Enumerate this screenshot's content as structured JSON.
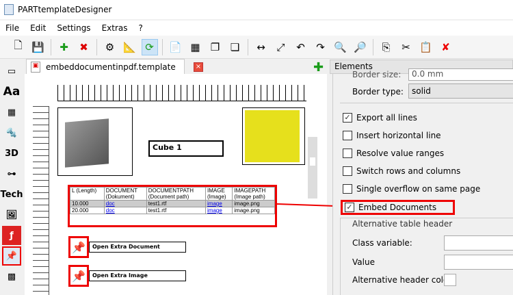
{
  "window": {
    "title": "PARTtemplateDesigner"
  },
  "menu": [
    "File",
    "Edit",
    "Settings",
    "Extras",
    "?"
  ],
  "toolbar": [
    {
      "icon": "new-file-icon",
      "g": "🗋"
    },
    {
      "icon": "save-icon",
      "g": "💾"
    },
    "sep",
    {
      "icon": "add-page-icon",
      "g": "✚"
    },
    {
      "icon": "delete-page-icon",
      "g": "✖"
    },
    "sep",
    {
      "icon": "settings-icon",
      "g": "⚙"
    },
    {
      "icon": "ruler-icon",
      "g": "📐"
    },
    {
      "icon": "refresh-icon",
      "g": "⟳",
      "active": true
    },
    "sep",
    {
      "icon": "export-pdf-icon",
      "g": "📄"
    },
    {
      "icon": "layers-icon",
      "g": "▦"
    },
    {
      "icon": "bring-front-icon",
      "g": "❐"
    },
    {
      "icon": "send-back-icon",
      "g": "❏"
    },
    "sep",
    {
      "icon": "fit-width-icon",
      "g": "↔"
    },
    {
      "icon": "fit-page-icon",
      "g": "⤢"
    },
    {
      "icon": "undo-icon",
      "g": "↶"
    },
    {
      "icon": "redo-icon",
      "g": "↷"
    },
    {
      "icon": "zoom-out-icon",
      "g": "🔍"
    },
    {
      "icon": "zoom-in-icon",
      "g": "🔎"
    },
    "sep",
    {
      "icon": "copy-icon",
      "g": "⎘"
    },
    {
      "icon": "cut-icon",
      "g": "✂"
    },
    {
      "icon": "paste-icon",
      "g": "📋"
    },
    {
      "icon": "delete-icon",
      "g": "✘"
    }
  ],
  "left_tools": [
    {
      "icon": "shape-icon",
      "g": "▭"
    },
    {
      "icon": "text-icon",
      "g": "Aa"
    },
    {
      "icon": "table-icon",
      "g": "▦"
    },
    {
      "icon": "screw-icon",
      "g": "🔩"
    },
    {
      "icon": "3d-icon",
      "g": "3D"
    },
    {
      "icon": "dimension-icon",
      "g": "⊶"
    },
    {
      "icon": "tech-icon",
      "g": "Tech"
    },
    {
      "icon": "image-icon",
      "g": "🖼"
    },
    {
      "icon": "pdf-icon",
      "g": "ƒ"
    },
    {
      "icon": "pin-icon",
      "g": "📌",
      "selected": true
    },
    {
      "icon": "qr-icon",
      "g": "▩"
    }
  ],
  "doc": {
    "tab": "embeddocumentinpdf.template",
    "cube_label": "Cube 1",
    "table": {
      "rows": [
        [
          "L (Length)",
          "DOCUMENT\n(Dokument)",
          "DOCUMENTPATH\n(Document path)",
          "IMAGE\n(Image)",
          "IMAGEPATH\n(Image path)"
        ],
        [
          "10.000",
          "doc",
          "test1.rtf",
          "image",
          "image.png"
        ],
        [
          "20.000",
          "doc",
          "test1.rtf",
          "image",
          "image.png"
        ]
      ]
    },
    "pins": [
      "Open Extra Document",
      "Open Extra Image"
    ]
  },
  "panel": {
    "title": "Elements",
    "border_size_label": "Border size:",
    "border_size_value": "0.0 mm",
    "border_type_label": "Border type:",
    "border_type_value": "solid",
    "checkboxes": [
      {
        "label": "Export all lines",
        "checked": true
      },
      {
        "label": "Insert horizontal line",
        "checked": false
      },
      {
        "label": "Resolve value ranges",
        "checked": false
      },
      {
        "label": "Switch rows and columns",
        "checked": false
      },
      {
        "label": "Single overflow on same page",
        "checked": false
      },
      {
        "label": "Embed Documents",
        "checked": true
      }
    ],
    "alt_header": "Alternative table header",
    "class_variable": "Class variable:",
    "value": "Value",
    "alt_header_color": "Alternative header color:"
  },
  "colors": {
    "highlight": "#e00000",
    "selection": "#cce4f7"
  }
}
